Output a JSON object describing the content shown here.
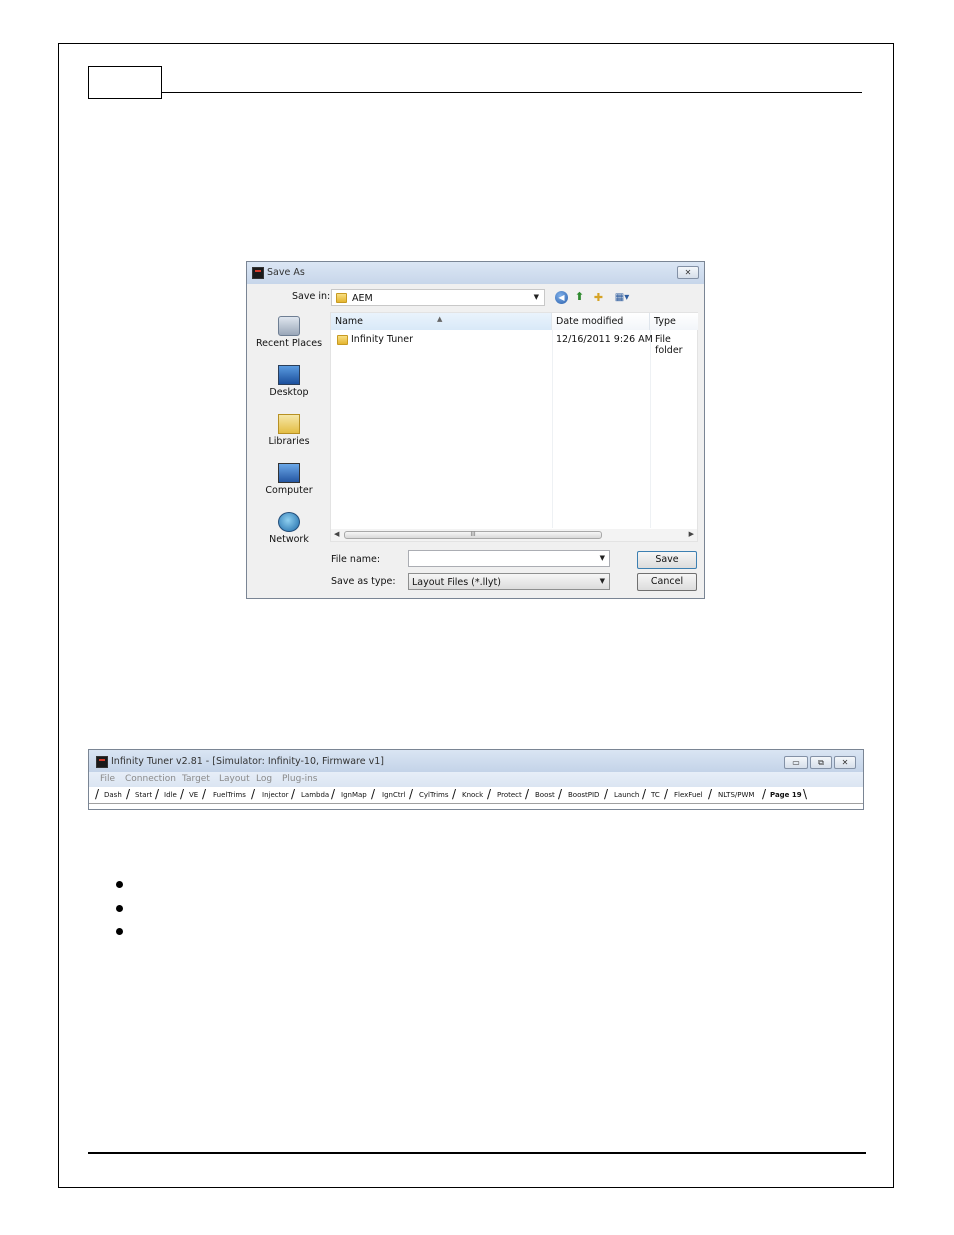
{
  "dialog": {
    "title": "Save As",
    "save_in_label": "Save in:",
    "save_in_value": "AEM",
    "places": [
      {
        "label": "Recent Places",
        "icon": "recent-places-icon"
      },
      {
        "label": "Desktop",
        "icon": "desktop-icon"
      },
      {
        "label": "Libraries",
        "icon": "libraries-icon"
      },
      {
        "label": "Computer",
        "icon": "computer-icon"
      },
      {
        "label": "Network",
        "icon": "network-icon"
      }
    ],
    "columns": {
      "name": "Name",
      "date": "Date modified",
      "type": "Type"
    },
    "rows": [
      {
        "name": "Infinity Tuner",
        "date": "12/16/2011 9:26 AM",
        "type": "File folder"
      }
    ],
    "scroll_grip": "III",
    "file_name_label": "File name:",
    "file_name_value": "",
    "save_type_label": "Save as type:",
    "save_type_value": "Layout Files (*.llyt)",
    "save_button": "Save",
    "cancel_button": "Cancel",
    "close_glyph": "✕"
  },
  "tuner": {
    "title": "Infinity Tuner v2.81 - [Simulator: Infinity-10, Firmware v1]",
    "menu": [
      "File",
      "Connection",
      "Target",
      "Layout",
      "Log",
      "Plug-ins"
    ],
    "tabs": [
      "Dash",
      "Start",
      "Idle",
      "VE",
      "FuelTrims",
      "Injector",
      "Lambda",
      "IgnMap",
      "IgnCtrl",
      "CylTrims",
      "Knock",
      "Protect",
      "Boost",
      "BoostPID",
      "Launch",
      "TC",
      "FlexFuel",
      "NLTS/PWM",
      "Page 19"
    ],
    "active_tab": "Page 19",
    "window_glyphs": {
      "minimize": "▭",
      "maximize": "⧉",
      "close": "✕"
    }
  }
}
